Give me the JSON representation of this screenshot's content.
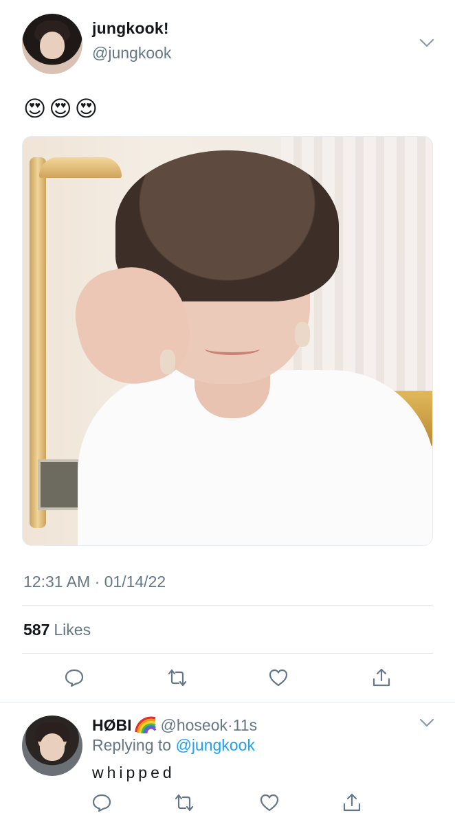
{
  "tweet": {
    "display_name": "jungkook!",
    "handle": "@jungkook",
    "text": "😍😍😍",
    "timestamp": "12:31 AM · 01/14/22",
    "likes_count": "587",
    "likes_label": "Likes",
    "image_alt": "photo"
  },
  "reply": {
    "display_name": "HØBI",
    "handle": "@hoseok",
    "time": "11s",
    "separator": "·",
    "replying_prefix": "Replying to",
    "replying_to": "@jungkook",
    "text": "whipped"
  },
  "icons": {
    "reply": "reply-icon",
    "retweet": "retweet-icon",
    "like": "heart-icon",
    "share": "share-icon",
    "more": "chevron-down-icon",
    "badge": "rainbow-emoji"
  },
  "colors": {
    "text": "#14171a",
    "secondary": "#657786",
    "link": "#1da1f2",
    "divider": "#e1e8ed"
  }
}
